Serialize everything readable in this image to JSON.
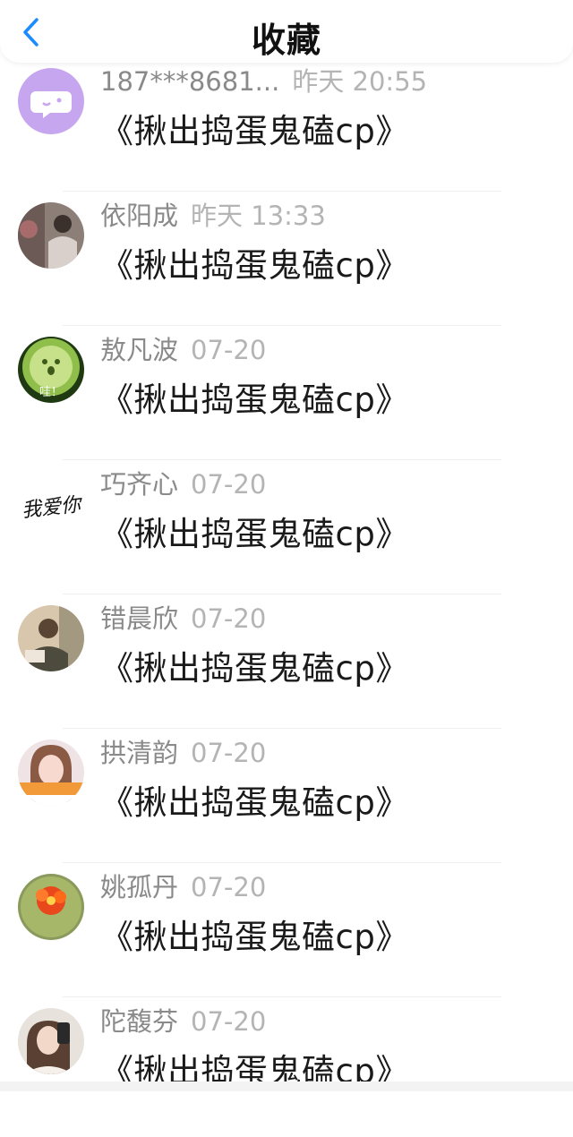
{
  "header": {
    "title": "收藏",
    "back_icon": "chevron-left-icon",
    "accent_color": "#1a8cff"
  },
  "items": [
    {
      "name": "187***8681...",
      "time": "昨天 20:55",
      "title": "《揪出捣蛋鬼磕cp》",
      "avatar": "chat-bubble-avatar"
    },
    {
      "name": "依阳成",
      "time": "昨天 13:33",
      "title": "《揪出捣蛋鬼磕cp》",
      "avatar": "person-photo-avatar"
    },
    {
      "name": "敖凡波",
      "time": "07-20",
      "title": "《揪出捣蛋鬼磕cp》",
      "avatar": "cucumber-face-avatar",
      "avatar_text": "哇！"
    },
    {
      "name": "巧齐心",
      "time": "07-20",
      "title": "《揪出捣蛋鬼磕cp》",
      "avatar": "handwriting-avatar",
      "avatar_text": "我爱你"
    },
    {
      "name": "错晨欣",
      "time": "07-20",
      "title": "《揪出捣蛋鬼磕cp》",
      "avatar": "person-photo-avatar"
    },
    {
      "name": "拱清韵",
      "time": "07-20",
      "title": "《揪出捣蛋鬼磕cp》",
      "avatar": "girl-photo-avatar"
    },
    {
      "name": "姚孤丹",
      "time": "07-20",
      "title": "《揪出捣蛋鬼磕cp》",
      "avatar": "cactus-flower-avatar"
    },
    {
      "name": "陀馥芬",
      "time": "07-20",
      "title": "《揪出捣蛋鬼磕cp》",
      "avatar": "selfie-photo-avatar"
    }
  ]
}
